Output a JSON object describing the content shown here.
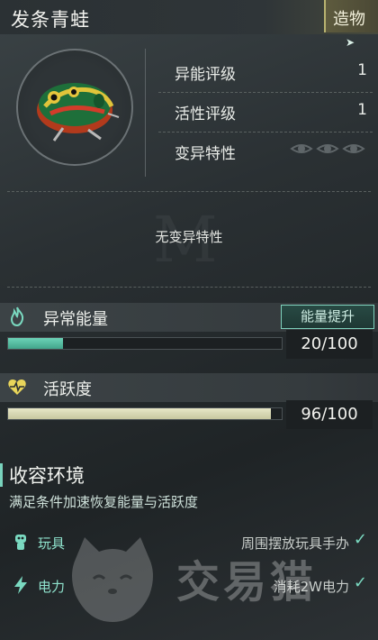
{
  "header": {
    "title": "发条青蛙",
    "tag": "造物"
  },
  "stats": [
    {
      "label": "异能评级",
      "value": "1"
    },
    {
      "label": "活性评级",
      "value": "1"
    },
    {
      "label": "变异特性",
      "value": ""
    }
  ],
  "traits": {
    "empty_text": "无变异特性"
  },
  "energy": {
    "label": "异常能量",
    "boost_label": "能量提升",
    "value_text": "20/100",
    "fraction": 0.2,
    "icon": "flame-icon"
  },
  "activity": {
    "label": "活跃度",
    "value_text": "96/100",
    "fraction": 0.96,
    "icon": "heart-pulse-icon"
  },
  "containment": {
    "title": "收容环境",
    "description": "满足条件加速恢复能量与活跃度",
    "conditions": [
      {
        "label": "玩具",
        "detail": "周围摆放玩具手办",
        "icon": "toy-icon",
        "met": true
      },
      {
        "label": "电力",
        "detail": "消耗2W电力",
        "icon": "lightning-icon",
        "met": true
      }
    ]
  },
  "watermark": {
    "text": "交易猫"
  },
  "colors": {
    "accent": "#79d3bd",
    "energy_fill": "#55bca0",
    "activity_fill": "#d8d8b6",
    "tag_bg": "#5e5b3e"
  }
}
